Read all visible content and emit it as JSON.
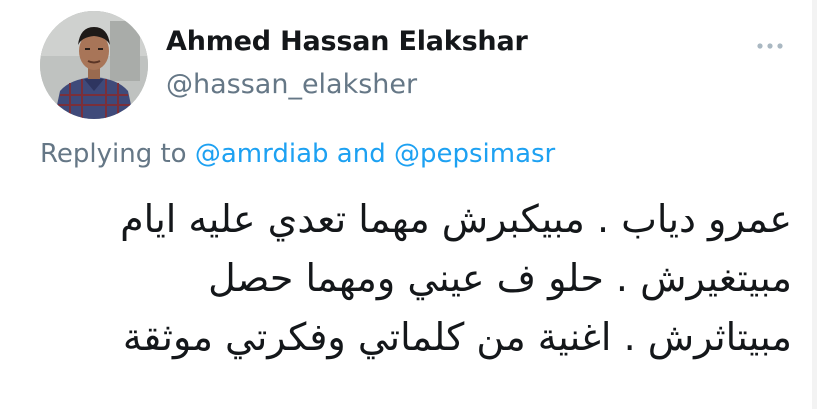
{
  "tweet": {
    "author": {
      "display_name": "Ahmed Hassan Elakshar",
      "handle": "@hassan_elaksher"
    },
    "more_icon": "more-dots-icon",
    "reply": {
      "prefix": "Replying to",
      "mention_1": "@amrdiab",
      "conjunction": "and",
      "mention_2": "@pepsimasr"
    },
    "text_lines": [
      "عمرو دياب . مبيكبرش مهما تعدي عليه ايام",
      "مبيتغيرش . حلو ف عيني ومهما حصل",
      "مبيتاثرش . اغنية من كلماتي وفكرتي موثقة"
    ]
  },
  "colors": {
    "text_primary": "#14171a",
    "text_secondary": "#657786",
    "link": "#1da1f2"
  }
}
